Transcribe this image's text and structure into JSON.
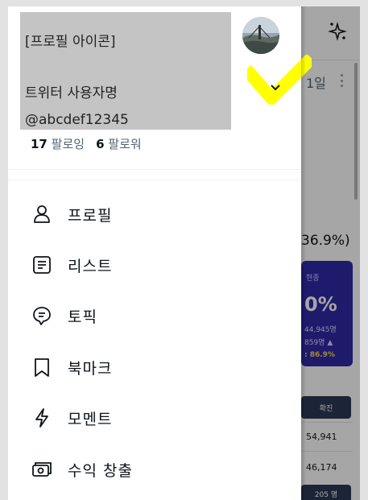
{
  "profile": {
    "icon_placeholder": "[프로필 아이콘]",
    "display_name": "트위터 사용자명",
    "handle": "@abcdef12345",
    "following_count": "17",
    "following_label": "팔로잉",
    "followers_count": "6",
    "followers_label": "팔로워"
  },
  "menu": [
    {
      "label": "프로필",
      "icon": "person-icon"
    },
    {
      "label": "리스트",
      "icon": "list-icon"
    },
    {
      "label": "토픽",
      "icon": "topic-icon"
    },
    {
      "label": "북마크",
      "icon": "bookmark-icon"
    },
    {
      "label": "모멘트",
      "icon": "lightning-icon"
    },
    {
      "label": "수익 창출",
      "icon": "money-icon"
    }
  ],
  "background": {
    "time": "1일",
    "percent": "36.9%)",
    "card_label": "현종",
    "card_big": "0%",
    "card_line1": "44,945명",
    "card_line2": "859명 ▲",
    "card_line3": ": 86.9%",
    "chip": "확진",
    "num1": "54,941",
    "num2": "46,174",
    "chip2": "205 명"
  },
  "colors": {
    "highlight": "#ffff00",
    "text": "#0f1419",
    "muted": "#536471",
    "redaction": "#c4c4c4"
  }
}
